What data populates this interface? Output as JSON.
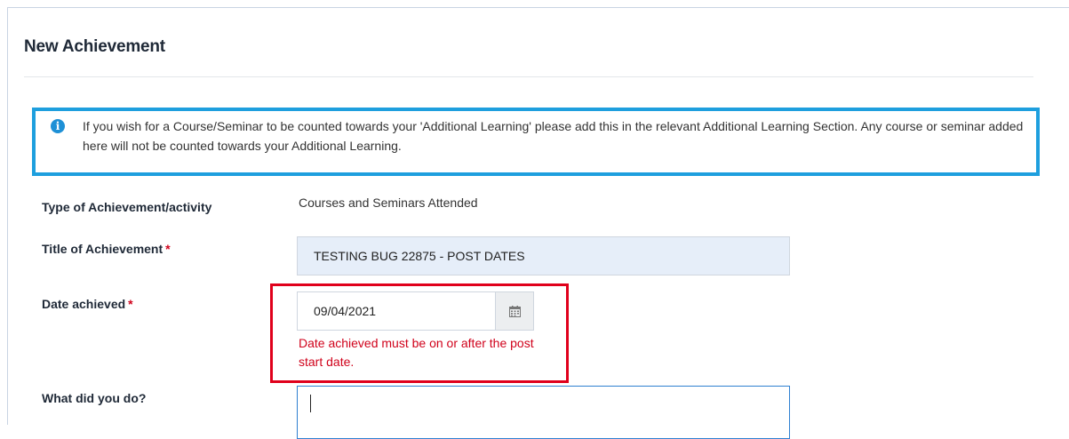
{
  "form": {
    "title": "New Achievement",
    "info": "If you wish for a Course/Seminar to be counted towards your 'Additional Learning' please add this in the relevant Additional Learning Section. Any course or seminar added here will not be counted towards your Additional Learning.",
    "required_marker": "*",
    "type_label": "Type of Achievement/activity",
    "type_value": "Courses and Seminars Attended",
    "title_label": "Title of Achievement",
    "title_value": "TESTING BUG 22875 - POST DATES",
    "date_label": "Date achieved",
    "date_value": "09/04/2021",
    "date_error": "Date achieved must be on or after the post start date.",
    "what_label": "What did you do?",
    "what_value": ""
  },
  "colors": {
    "info_border": "#1e9fde",
    "error": "#d0021b",
    "input_filled_bg": "#e6eef9",
    "focus_border": "#2f80d1"
  },
  "icons": {
    "info": "info-circle-icon",
    "calendar": "calendar-icon"
  }
}
